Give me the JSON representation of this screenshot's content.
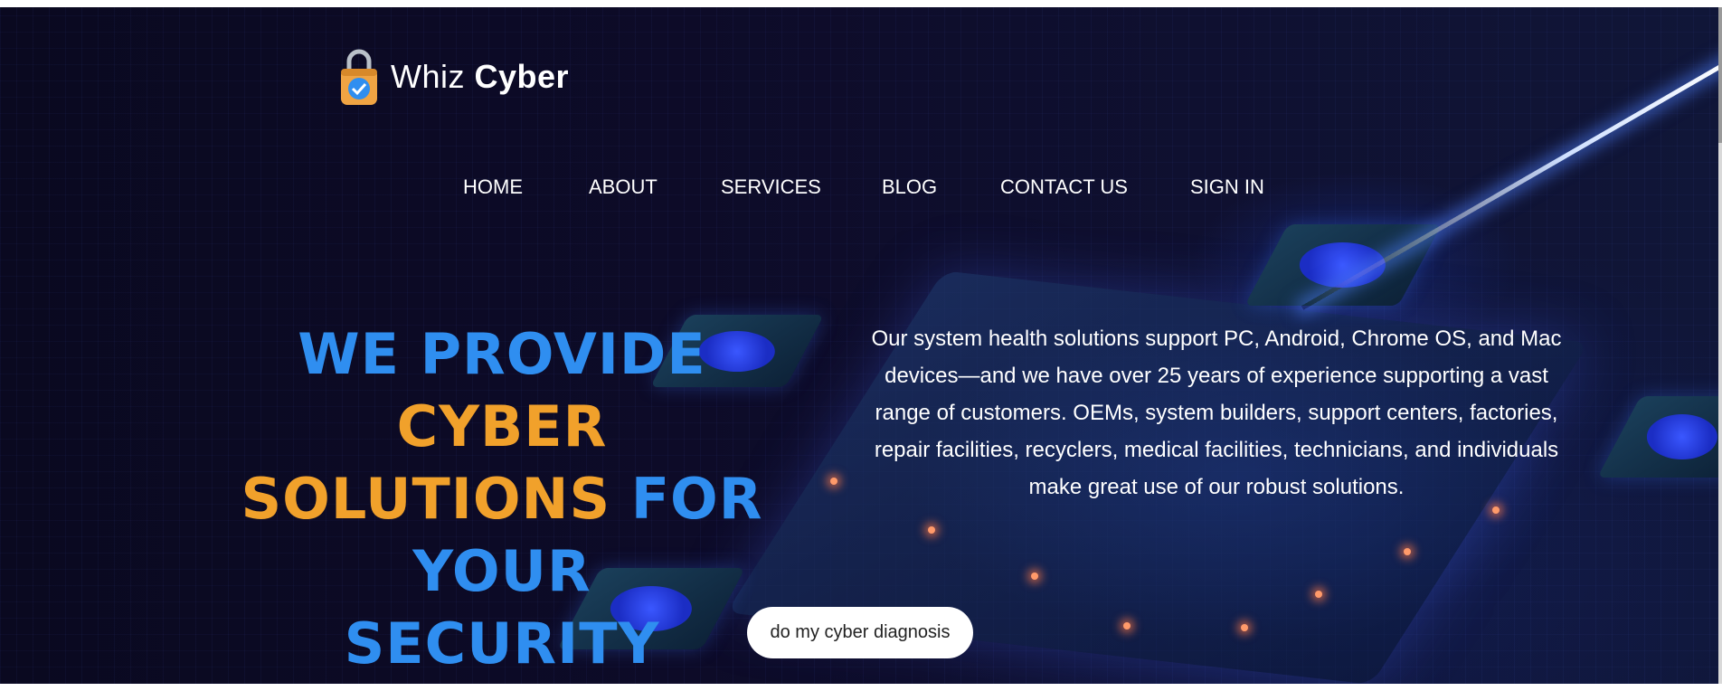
{
  "brand": {
    "name_light": "Whiz",
    "name_bold": "Cyber",
    "logo_icon": "padlock-shield-icon",
    "colors": {
      "blue": "#2f8ef0",
      "orange": "#f1a12b",
      "background": "#0c0a26"
    }
  },
  "nav": {
    "items": [
      {
        "label": "HOME"
      },
      {
        "label": "ABOUT"
      },
      {
        "label": "SERVICES"
      },
      {
        "label": "BLOG"
      },
      {
        "label": "CONTACT US"
      },
      {
        "label": "SIGN IN"
      }
    ]
  },
  "hero": {
    "headline": {
      "part1": "WE PROVIDE ",
      "part2": "CYBER",
      "part3": "SOLUTIONS ",
      "part4": "FOR YOUR",
      "part5": "SECURITY"
    },
    "description": "Our system health solutions support PC, Android, Chrome OS, and Mac devices—and we have over 25 years of experience supporting a vast range of customers. OEMs, system builders, support centers, factories, repair facilities, recyclers, medical facilities, technicians, and individuals make great use of our robust solutions.",
    "cta_label": "do my cyber diagnosis"
  }
}
